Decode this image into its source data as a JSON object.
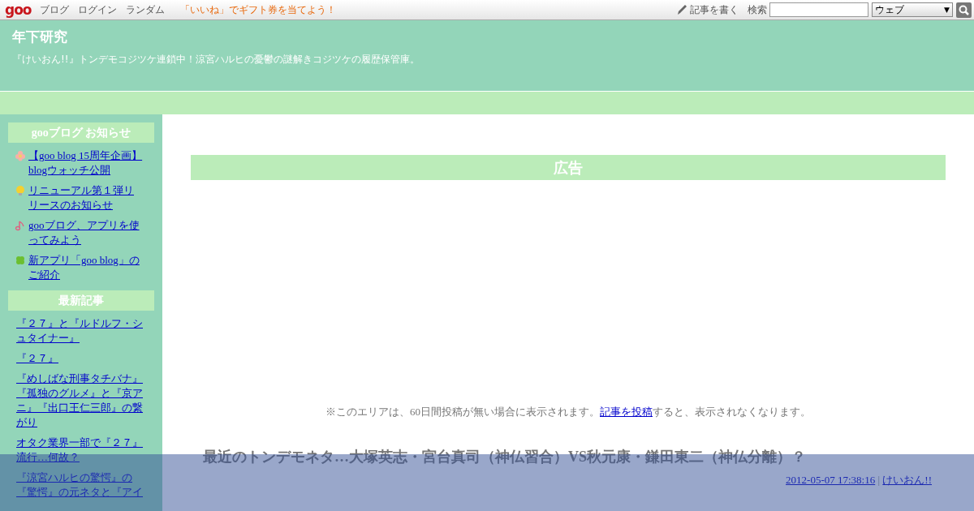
{
  "topbar": {
    "logo": "goo",
    "links": [
      "ブログ",
      "ログイン",
      "ランダム"
    ],
    "promo": "「いいね」でギフト券を当てよう！",
    "write": "記事を書く",
    "search_label": "検索",
    "search_scope": "ウェブ",
    "scope_arrow": "▼"
  },
  "header": {
    "title": "年下研究",
    "description": "『けいおん!!』トンデモコジツケ連鎖中！涼宮ハルヒの憂鬱の謎解きコジツケの履歴保管庫。"
  },
  "sidebar": {
    "sections": [
      {
        "heading": "gooブログ お知らせ",
        "items": [
          {
            "kind": "flower",
            "text": "【goo blog 15周年企画】blogウォッチ公開"
          },
          {
            "kind": "bulb",
            "text": "リニューアル第１弾リリースのお知らせ"
          },
          {
            "kind": "note",
            "text": "gooブログ、アプリを使ってみよう"
          },
          {
            "kind": "clover",
            "text": "新アプリ「goo blog」のご紹介"
          }
        ]
      },
      {
        "heading": "最新記事",
        "items": [
          {
            "kind": "plain",
            "text": "『２７』と『ルドルフ・シュタイナー』"
          },
          {
            "kind": "plain",
            "text": "『２７』"
          },
          {
            "kind": "plain",
            "text": "『めしばな刑事タチバナ』『孤独のグルメ』と『京アニ』『出口王仁三郎』の繋がり"
          },
          {
            "kind": "plain",
            "text": "オタク業界一部で『２７』流行…何故？"
          },
          {
            "kind": "plain",
            "text": "『涼宮ハルヒの驚愕』の『驚愕』の元ネタと『アイ"
          }
        ]
      }
    ]
  },
  "main": {
    "ad_heading": "広告",
    "notice": {
      "before": "※このエリアは、60日間投稿が無い場合に表示されます。",
      "link": "記事を投稿",
      "after": "すると、表示されなくなります。"
    },
    "post": {
      "title": "最近のトンデモネタ…大塚英志・宮台真司（神仏習合）VS秋元康・鎌田東二（神仏分離）？",
      "date": "2012-05-07 17:38:16",
      "separator": "|",
      "author": "けいおん!!"
    }
  }
}
